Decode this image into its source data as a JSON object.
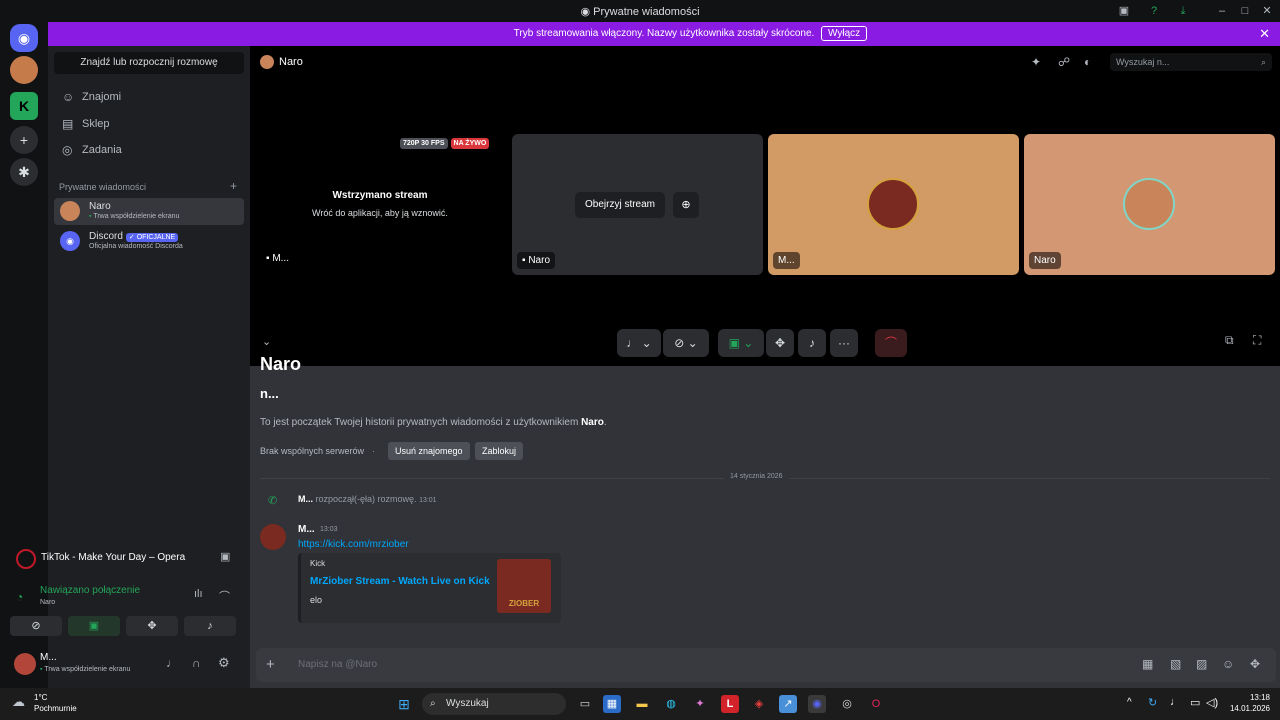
{
  "window": {
    "title": "Prywatne wiadomości"
  },
  "banner": {
    "message": "Tryb streamowania włączony. Nazwy użytkownika zostały skrócone.",
    "button": "Wyłącz"
  },
  "sidebar": {
    "find_label": "Znajdź lub rozpocznij rozmowę",
    "nav": [
      {
        "label": "Znajomi"
      },
      {
        "label": "Sklep"
      },
      {
        "label": "Zadania"
      }
    ],
    "dm_header": "Prywatne wiadomości",
    "dms": [
      {
        "name": "Naro",
        "status": "Trwa współdzielenie ekranu"
      },
      {
        "name": "Discord",
        "badge": "✓ OFICJALNE",
        "status": "Oficjalna wiadomość Discorda"
      }
    ]
  },
  "opera": {
    "title": "TikTok - Make Your Day – Opera"
  },
  "voice": {
    "status": "Nawiązano połączenie",
    "channel": "Naro"
  },
  "user": {
    "name": "M...",
    "status": "Trwa współdzielenie ekranu"
  },
  "channel": {
    "name": "Naro",
    "search_placeholder": "Wyszukaj n..."
  },
  "stream": {
    "quality": "720P 30 FPS",
    "live": "NA ŻYWO",
    "paused_title": "Wstrzymano stream",
    "paused_sub": "Wróć do aplikacji, aby ją wznowić.",
    "self_label": "M...",
    "watch_button": "Obejrzyj stream",
    "tiles": [
      {
        "label": "Naro"
      },
      {
        "label": "M..."
      },
      {
        "label": "Naro"
      }
    ]
  },
  "chat": {
    "header_partial": "Naro",
    "sub_name": "n...",
    "intro_prefix": "To jest początek Twojej historii prywatnych wiadomości z użytkownikiem ",
    "intro_name": "Naro",
    "intro_suffix": ".",
    "no_servers": "Brak wspólnych serwerów",
    "remove_friend": "Usuń znajomego",
    "block": "Zablokuj",
    "date_divider": "14 stycznia 2026",
    "call_author": "M...",
    "call_text": "rozpoczął(-ęła) rozmowę.",
    "call_time": "13:01",
    "msg_author": "M...",
    "msg_time": "13:03",
    "msg_link": "https://kick.com/mrziober",
    "embed_provider": "Kick",
    "embed_title": "MrZiober Stream - Watch Live on Kick",
    "embed_desc": "elo",
    "embed_thumb_text": "ZIOBER",
    "composer_placeholder": "Napisz na @Naro"
  },
  "taskbar": {
    "weather_temp": "1°C",
    "weather_desc": "Pochmurnie",
    "search": "Wyszukaj",
    "time": "13:18",
    "date": "14.01.2026"
  },
  "colors": {
    "accent": "#5865f2",
    "banner": "#8a1be3",
    "online": "#23a55a"
  }
}
